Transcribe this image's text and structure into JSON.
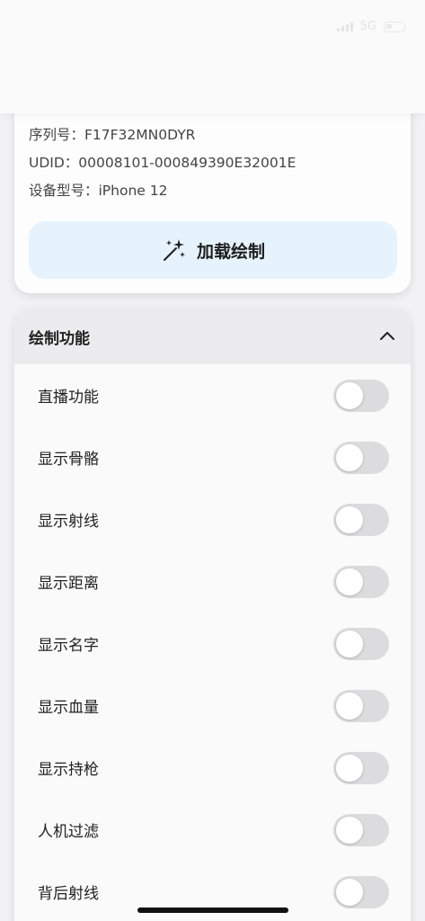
{
  "status_bar": {
    "network": "5G"
  },
  "device_info": {
    "serial": "序列号：F17F32MN0DYR",
    "udid": "UDID：00008101-000849390E32001E",
    "model": "设备型号：iPhone 12"
  },
  "load_button": {
    "label": "加载绘制",
    "icon": "magic-wand-sparkles-icon"
  },
  "draw_section": {
    "title": "绘制功能",
    "toggles": [
      {
        "label": "直播功能",
        "on": false
      },
      {
        "label": "显示骨骼",
        "on": false
      },
      {
        "label": "显示射线",
        "on": false
      },
      {
        "label": "显示距离",
        "on": false
      },
      {
        "label": "显示名字",
        "on": false
      },
      {
        "label": "显示血量",
        "on": false
      },
      {
        "label": "显示持枪",
        "on": false
      },
      {
        "label": "人机过滤",
        "on": false
      },
      {
        "label": "背后射线",
        "on": false
      }
    ]
  },
  "colors": {
    "page_bg": "#f2f2f4",
    "button_bg": "#e6f3fd",
    "switch_off": "#dcdcde",
    "section_header_bg": "#ececee"
  }
}
